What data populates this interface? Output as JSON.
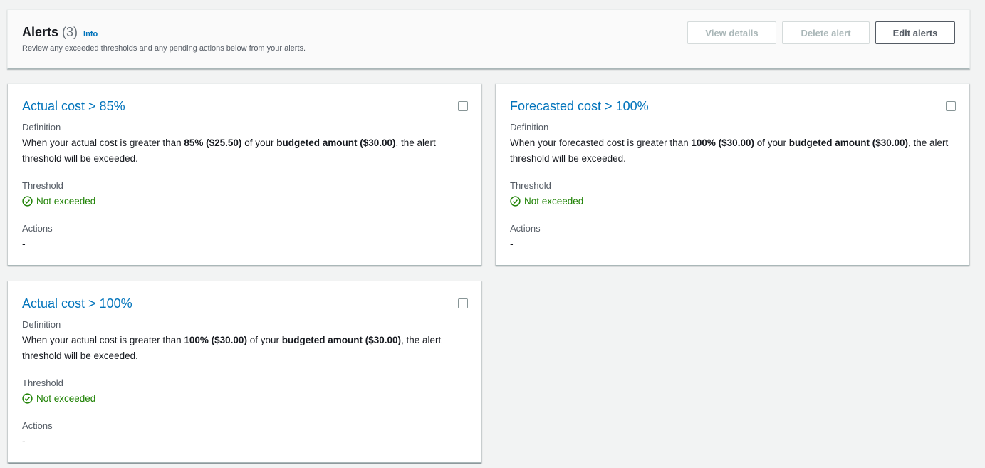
{
  "header": {
    "title": "Alerts",
    "count": "(3)",
    "info": "Info",
    "description": "Review any exceeded thresholds and any pending actions below from your alerts.",
    "buttons": {
      "view_details": "View details",
      "delete_alert": "Delete alert",
      "edit_alerts": "Edit alerts"
    }
  },
  "labels": {
    "definition": "Definition",
    "threshold": "Threshold",
    "actions": "Actions"
  },
  "cards": [
    {
      "title": "Actual cost > 85%",
      "def_1": "When your actual cost is greater than ",
      "def_pct": "85% ($25.50)",
      "def_2": " of your ",
      "def_budget": "budgeted amount ($30.00)",
      "def_3": ", the alert threshold will be exceeded.",
      "status": "Not exceeded",
      "actions": "-"
    },
    {
      "title": "Forecasted cost > 100%",
      "def_1": "When your forecasted cost is greater than ",
      "def_pct": "100% ($30.00)",
      "def_2": " of your ",
      "def_budget": "budgeted amount ($30.00)",
      "def_3": ", the alert threshold will be exceeded.",
      "status": "Not exceeded",
      "actions": "-"
    },
    {
      "title": "Actual cost > 100%",
      "def_1": "When your actual cost is greater than ",
      "def_pct": "100% ($30.00)",
      "def_2": " of your ",
      "def_budget": "budgeted amount ($30.00)",
      "def_3": ", the alert threshold will be exceeded.",
      "status": "Not exceeded",
      "actions": "-"
    }
  ],
  "colors": {
    "link": "#0073bb",
    "success": "#1d8102",
    "background": "#f2f3f3"
  }
}
